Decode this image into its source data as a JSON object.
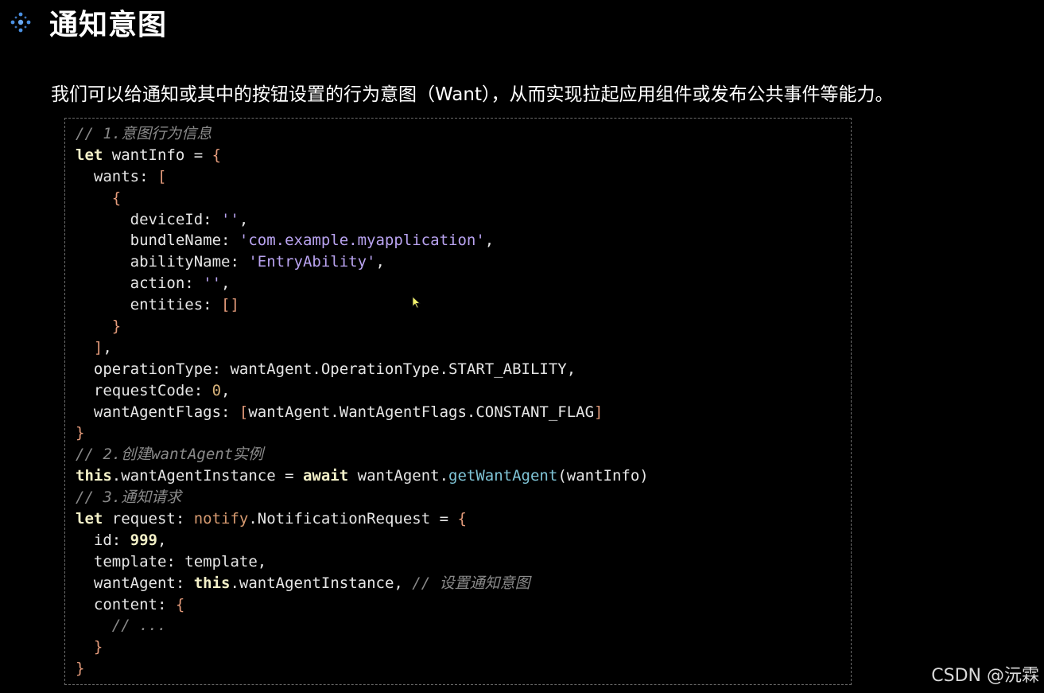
{
  "header": {
    "title": "通知意图",
    "icon": "sparkle-diamond-icon",
    "accent_color": "#4a90e2"
  },
  "intro": {
    "text": "我们可以给通知或其中的按钮设置的行为意图（Want），从而实现拉起应用组件或发布公共事件等能力。"
  },
  "code": {
    "lines": [
      [
        {
          "t": "// 1.意图行为信息",
          "c": "comment"
        }
      ],
      [
        {
          "t": "let",
          "c": "kw"
        },
        {
          "t": " wantInfo = "
        },
        {
          "t": "{",
          "c": "brk"
        }
      ],
      [
        {
          "t": "  wants: "
        },
        {
          "t": "[",
          "c": "brk"
        }
      ],
      [
        {
          "t": "    "
        },
        {
          "t": "{",
          "c": "brk"
        }
      ],
      [
        {
          "t": "      deviceId: "
        },
        {
          "t": "''",
          "c": "str"
        },
        {
          "t": ","
        }
      ],
      [
        {
          "t": "      bundleName: "
        },
        {
          "t": "'com.example.myapplication'",
          "c": "str"
        },
        {
          "t": ","
        }
      ],
      [
        {
          "t": "      abilityName: "
        },
        {
          "t": "'EntryAbility'",
          "c": "str"
        },
        {
          "t": ","
        }
      ],
      [
        {
          "t": "      action: "
        },
        {
          "t": "''",
          "c": "str"
        },
        {
          "t": ","
        }
      ],
      [
        {
          "t": "      entities: "
        },
        {
          "t": "[]",
          "c": "brk"
        }
      ],
      [
        {
          "t": "    "
        },
        {
          "t": "}",
          "c": "brk"
        }
      ],
      [
        {
          "t": "  "
        },
        {
          "t": "]",
          "c": "brk"
        },
        {
          "t": ","
        }
      ],
      [
        {
          "t": "  operationType: wantAgent.OperationType.START_ABILITY,"
        }
      ],
      [
        {
          "t": "  requestCode: "
        },
        {
          "t": "0",
          "c": "num"
        },
        {
          "t": ","
        }
      ],
      [
        {
          "t": "  wantAgentFlags: "
        },
        {
          "t": "[",
          "c": "brk"
        },
        {
          "t": "wantAgent.WantAgentFlags.CONSTANT_FLAG"
        },
        {
          "t": "]",
          "c": "brk"
        }
      ],
      [
        {
          "t": "}",
          "c": "brk"
        }
      ],
      [
        {
          "t": "// 2.创建wantAgent实例",
          "c": "comment"
        }
      ],
      [
        {
          "t": "this",
          "c": "kw"
        },
        {
          "t": ".wantAgentInstance = "
        },
        {
          "t": "await",
          "c": "kw"
        },
        {
          "t": " wantAgent."
        },
        {
          "t": "getWantAgent",
          "c": "fn"
        },
        {
          "t": "(wantInfo)"
        }
      ],
      [
        {
          "t": "// 3.通知请求",
          "c": "comment"
        }
      ],
      [
        {
          "t": "let",
          "c": "kw"
        },
        {
          "t": " request: "
        },
        {
          "t": "notify",
          "c": "mod"
        },
        {
          "t": ".NotificationRequest = "
        },
        {
          "t": "{",
          "c": "brk"
        }
      ],
      [
        {
          "t": "  id: "
        },
        {
          "t": "999",
          "c": "kw"
        },
        {
          "t": ","
        }
      ],
      [
        {
          "t": "  template: template,"
        }
      ],
      [
        {
          "t": "  wantAgent: "
        },
        {
          "t": "this",
          "c": "kw"
        },
        {
          "t": ".wantAgentInstance, "
        },
        {
          "t": "// 设置通知意图",
          "c": "comment"
        }
      ],
      [
        {
          "t": "  content: "
        },
        {
          "t": "{",
          "c": "brk"
        }
      ],
      [
        {
          "t": "    "
        },
        {
          "t": "// ...",
          "c": "comment"
        }
      ],
      [
        {
          "t": "  "
        },
        {
          "t": "}",
          "c": "brk"
        }
      ],
      [
        {
          "t": "}",
          "c": "brk"
        }
      ]
    ],
    "colors": {
      "comment": "#8a8a8a",
      "keyword": "#f4f1c8",
      "string": "#b9a3f0",
      "bracket": "#e39a7a",
      "number": "#d7b27a",
      "function": "#7fc4d6"
    }
  },
  "cursor": {
    "icon": "mouse-pointer-icon",
    "color": "#f3f36b"
  },
  "watermark": {
    "text": "CSDN @沅霖"
  }
}
